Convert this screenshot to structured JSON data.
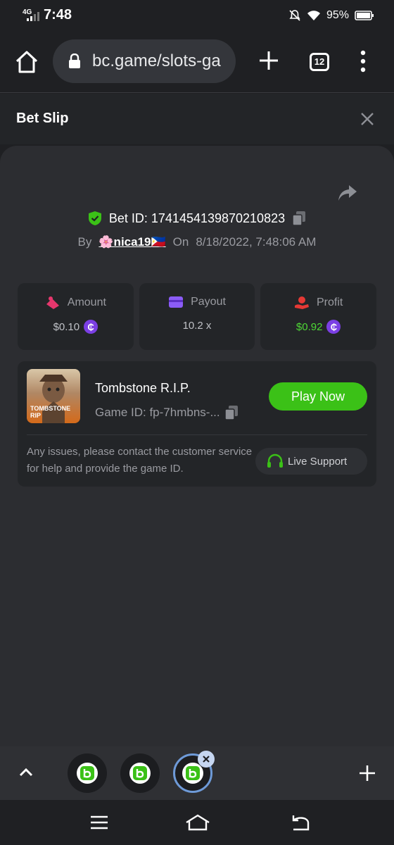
{
  "status_bar": {
    "network": "4G",
    "time": "7:48",
    "battery_percent": "95%"
  },
  "browser": {
    "url": "bc.game/slots-ga",
    "tab_count": "12"
  },
  "bet_slip": {
    "title": "Bet Slip",
    "bet_id_label": "Bet ID: 1741454139870210823",
    "by_label": "By",
    "username": "🌸nica19🇵🇭",
    "on_label": "On",
    "date": "8/18/2022, 7:48:06 AM",
    "stats": [
      {
        "label": "Amount",
        "value": "$0.10",
        "has_coin": true
      },
      {
        "label": "Payout",
        "value": "10.2 x",
        "has_coin": false
      },
      {
        "label": "Profit",
        "value": "$0.92",
        "has_coin": true
      }
    ],
    "coin_symbol": "₵",
    "game": {
      "thumb_text_1": "TOMBSTONE",
      "thumb_text_2": "RIP",
      "name": "Tombstone R.I.P.",
      "game_id": "Game ID: fp-7hmbns-...",
      "play_label": "Play Now"
    },
    "issue_text": "Any issues, please contact the customer service for help and provide the game ID.",
    "support_label": "Live Support"
  },
  "colors": {
    "accent_green": "#3bc117",
    "profit_green": "#4ed836",
    "coin_purple": "#7b3fe4",
    "amount_pink": "#e6376d",
    "payout_purple": "#8b5cf6",
    "profit_red": "#e53935"
  }
}
